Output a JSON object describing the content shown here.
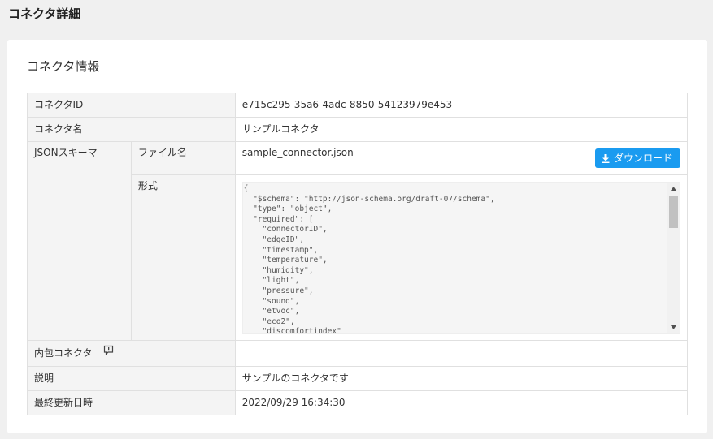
{
  "page": {
    "title": "コネクタ詳細"
  },
  "section": {
    "title": "コネクタ情報"
  },
  "rows": {
    "connector_id": {
      "label": "コネクタID",
      "value": "e715c295-35a6-4adc-8850-54123979e453"
    },
    "connector_name": {
      "label": "コネクタ名",
      "value": "サンプルコネクタ"
    },
    "json_schema": {
      "label": "JSONスキーマ",
      "file_label": "ファイル名",
      "file_value": "sample_connector.json",
      "download_label": "ダウンロード",
      "format_label": "形式",
      "format_value": "{\n  \"$schema\": \"http://json-schema.org/draft-07/schema\",\n  \"type\": \"object\",\n  \"required\": [\n    \"connectorID\",\n    \"edgeID\",\n    \"timestamp\",\n    \"temperature\",\n    \"humidity\",\n    \"light\",\n    \"pressure\",\n    \"sound\",\n    \"etvoc\",\n    \"eco2\",\n    \"discomfortindex\""
    },
    "inner_connector": {
      "label": "内包コネクタ",
      "value": ""
    },
    "description": {
      "label": "説明",
      "value": "サンプルのコネクタです"
    },
    "updated_at": {
      "label": "最終更新日時",
      "value": "2022/09/29 16:34:30"
    }
  },
  "icons": {
    "download": "download-icon",
    "help": "help-comment-icon"
  },
  "colors": {
    "accent": "#1a9bf0"
  }
}
